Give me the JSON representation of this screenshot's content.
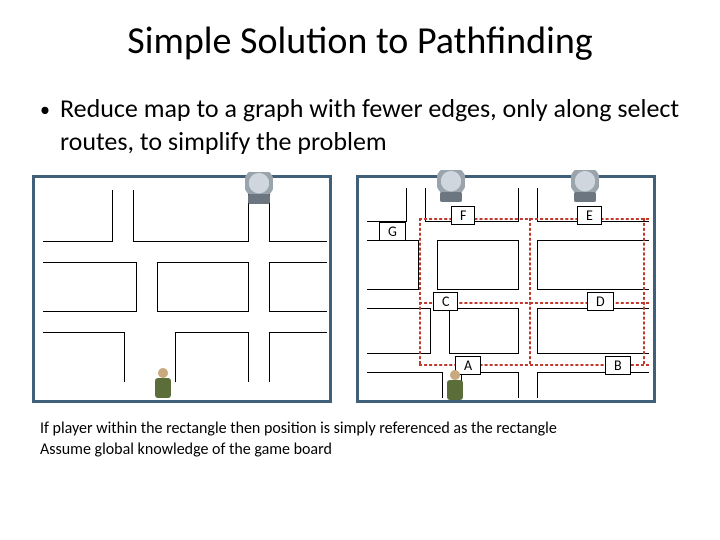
{
  "title": "Simple Solution to Pathfinding",
  "bullet": "Reduce map to a graph with fewer edges, only along select routes, to simplify the problem",
  "nodes": {
    "G": "G",
    "F": "F",
    "E": "E",
    "C": "C",
    "D": "D",
    "A": "A",
    "B": "B"
  },
  "footnote_line1": "If player within the rectangle then position is simply referenced as the rectangle",
  "footnote_line2": "Assume global knowledge of the game board"
}
